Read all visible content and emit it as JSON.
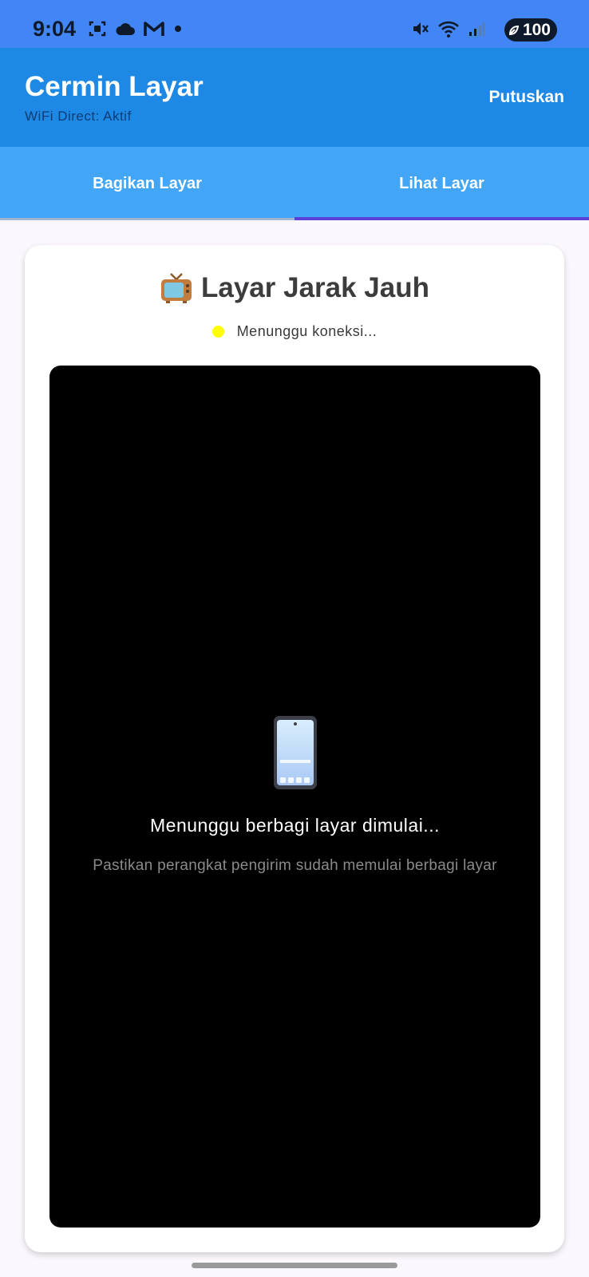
{
  "status_bar": {
    "time": "9:04",
    "left_icons": [
      "screenshot-icon",
      "cloud-icon",
      "gmail-icon",
      "dot-icon"
    ],
    "right_icons": [
      "mute-icon",
      "wifi-icon",
      "signal-icon"
    ],
    "battery": "100"
  },
  "app_bar": {
    "title": "Cermin Layar",
    "subtitle": "WiFi Direct: Aktif",
    "disconnect_label": "Putuskan"
  },
  "tabs": [
    {
      "label": "Bagikan Layar",
      "selected": false
    },
    {
      "label": "Lihat Layar",
      "selected": true
    }
  ],
  "card": {
    "title": "Layar Jarak Jauh",
    "status_text": "Menunggu koneksi...",
    "status_color": "#ffff00",
    "viewer": {
      "message": "Menunggu berbagi layar dimulai...",
      "hint": "Pastikan perangkat pengirim sudah memulai berbagi layar"
    }
  },
  "colors": {
    "status_bar": "#4285f4",
    "app_bar": "#1e88e5",
    "tab_bar": "#42a5f5",
    "tab_indicator": "#5c3fd6"
  }
}
